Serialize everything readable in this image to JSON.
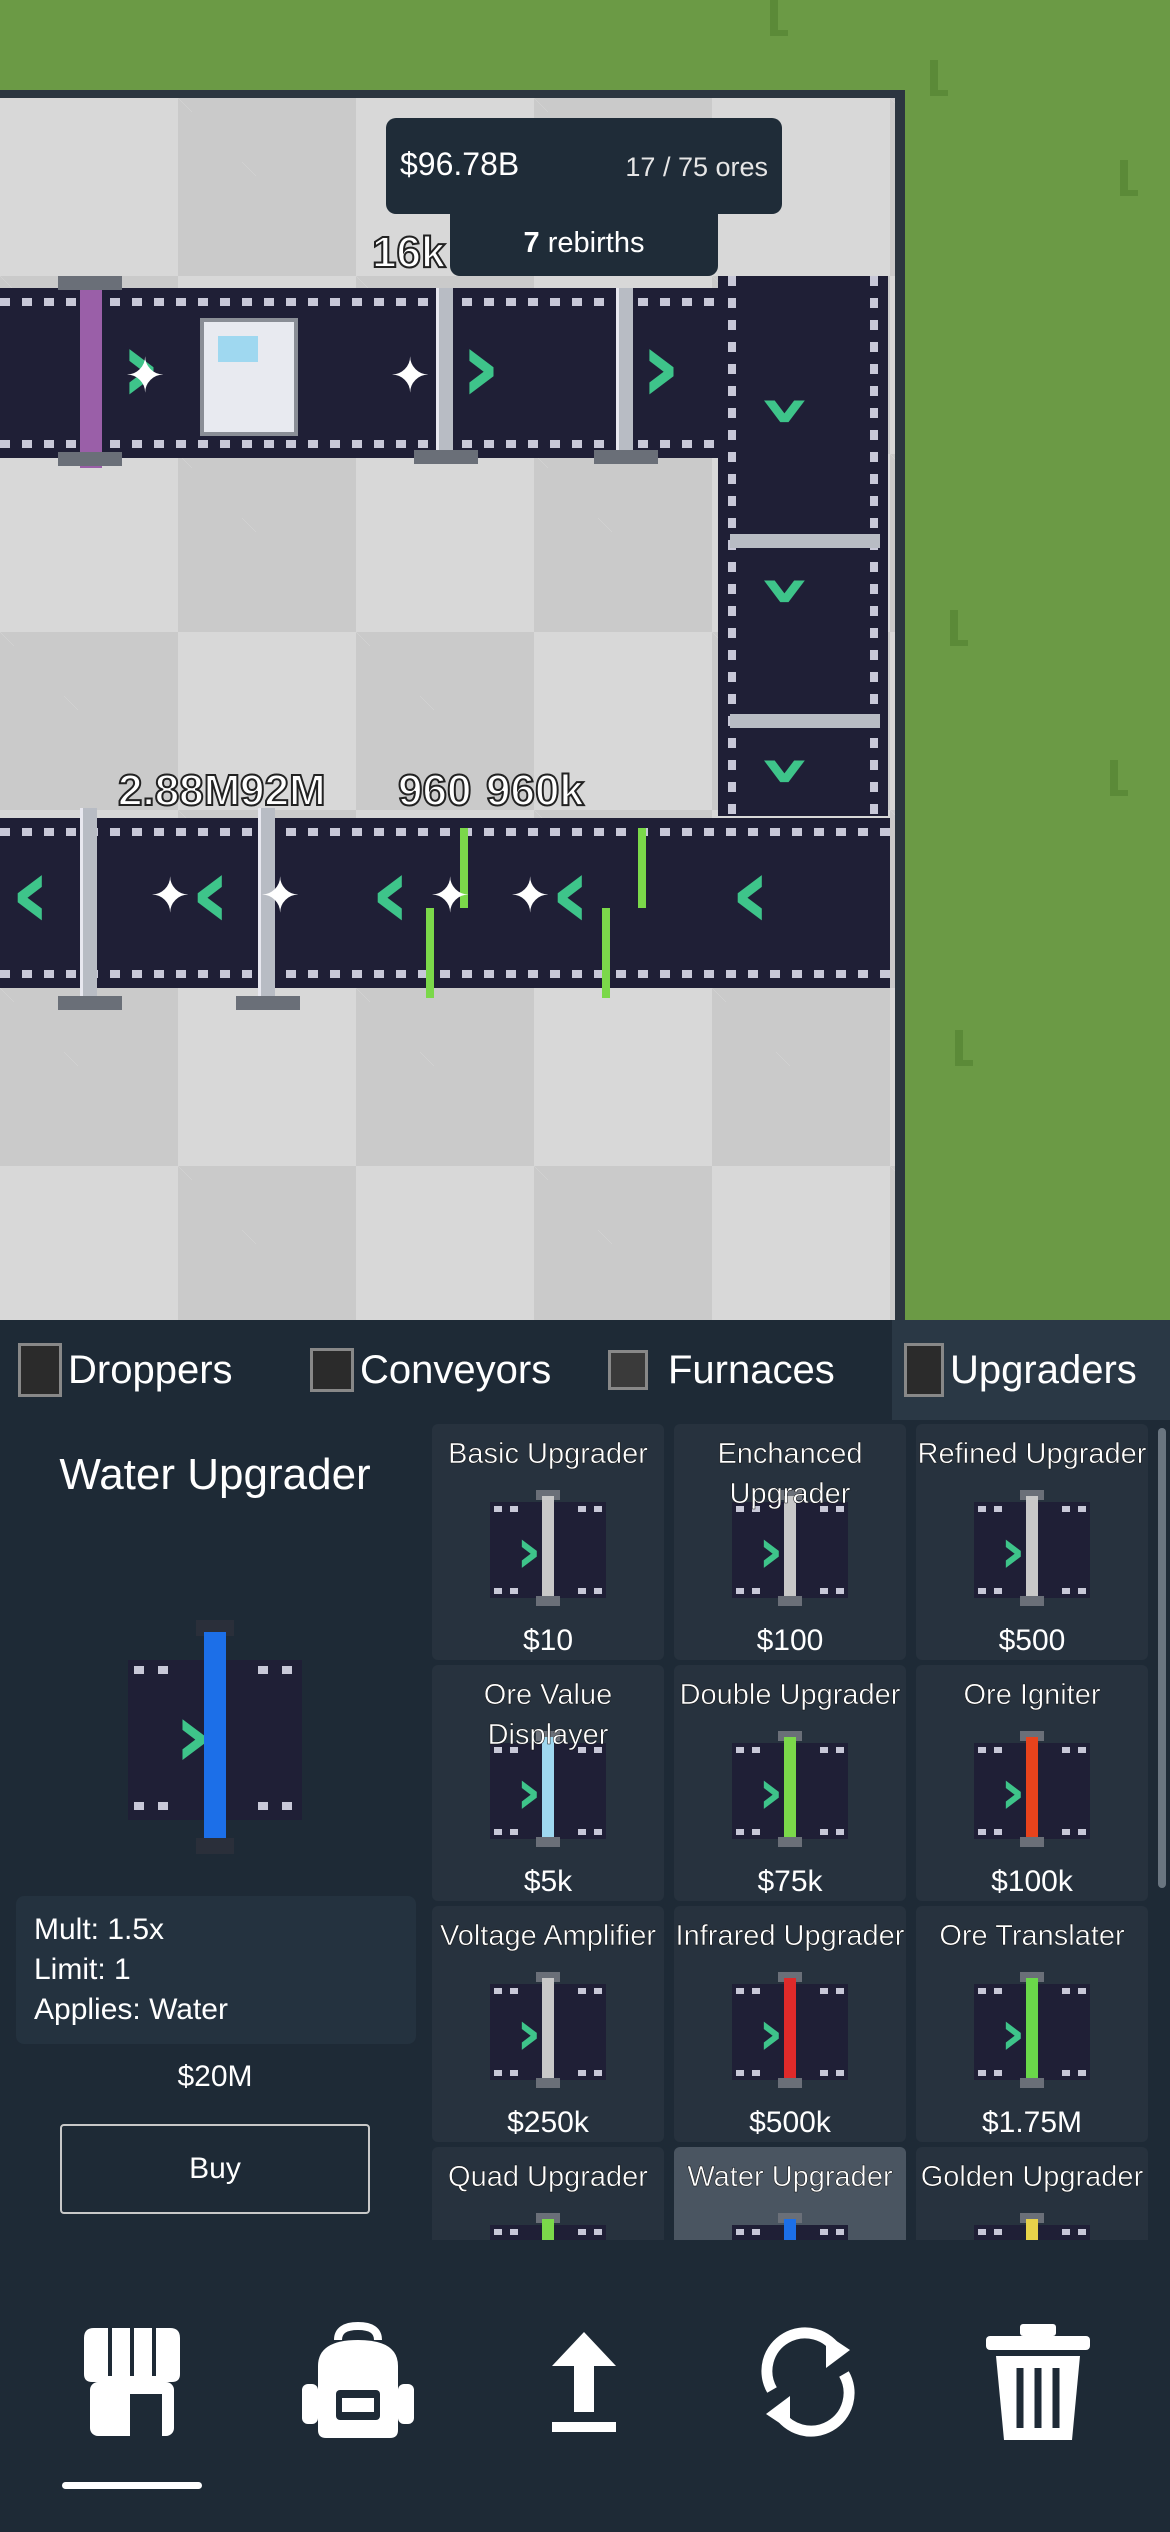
{
  "hud": {
    "money": "$96.78B",
    "ores": "17 / 75 ores",
    "rebirth_count": "7",
    "rebirth_label": " rebirths"
  },
  "float_labels": [
    "16k",
    "2.88M",
    "92M",
    "960",
    "960k"
  ],
  "tabs": [
    {
      "label": "Droppers",
      "icon": "dropper-icon"
    },
    {
      "label": "Conveyors",
      "icon": "conveyor-icon"
    },
    {
      "label": "Furnaces",
      "icon": "furnace-icon"
    },
    {
      "label": "Upgraders",
      "icon": "upgrader-icon",
      "active": true
    }
  ],
  "detail": {
    "title": "Water Upgrader",
    "stats": [
      "Mult: 1.5x",
      "Limit: 1",
      "Applies: Water"
    ],
    "price": "$20M",
    "buy_label": "Buy",
    "accent": "#1c6fe8"
  },
  "shop_items": [
    {
      "name": "Basic Upgrader",
      "price": "$10",
      "color": "#c8c8c8"
    },
    {
      "name": "Enchanced Upgrader",
      "price": "$100",
      "color": "#c8c8c8"
    },
    {
      "name": "Refined Upgrader",
      "price": "$500",
      "color": "#c8c8c8"
    },
    {
      "name": "Ore Value Displayer",
      "price": "$5k",
      "color": "#9fd8f0"
    },
    {
      "name": "Double Upgrader",
      "price": "$75k",
      "color": "#7bd84a"
    },
    {
      "name": "Ore Igniter",
      "price": "$100k",
      "color": "#e8431c"
    },
    {
      "name": "Voltage Amplifier",
      "price": "$250k",
      "color": "#c8c8c8"
    },
    {
      "name": "Infrared Upgrader",
      "price": "$500k",
      "color": "#e02a2a"
    },
    {
      "name": "Ore Translater",
      "price": "$1.75M",
      "color": "#6ad84a"
    },
    {
      "name": "Quad Upgrader",
      "price": "",
      "color": "#7bd84a"
    },
    {
      "name": "Water Upgrader",
      "price": "",
      "color": "#1c6fe8",
      "selected": true
    },
    {
      "name": "Golden Upgrader",
      "price": "",
      "color": "#e8d24a"
    }
  ],
  "bottom_nav": [
    "shop-icon",
    "backpack-icon",
    "upload-icon",
    "rebirth-icon",
    "trash-icon"
  ],
  "colors": {
    "panel": "#1e2a36",
    "card": "#27323e",
    "grass": "#6b9a45",
    "chevron": "#3ec48a"
  }
}
